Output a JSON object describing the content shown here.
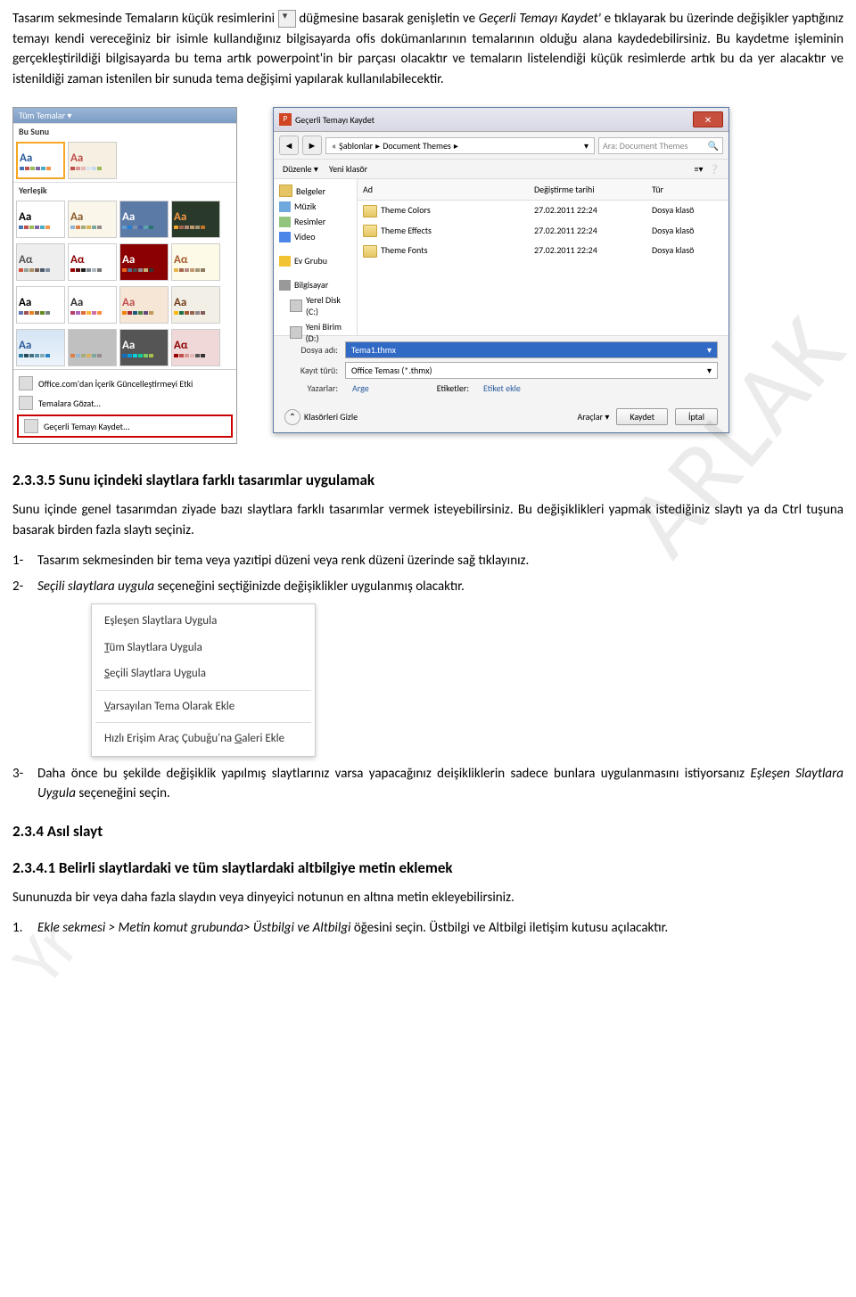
{
  "para1_a": "Tasarım sekmesinde  Temaların küçük resimlerini",
  "para1_b": "düğmesine basarak genişletin ve ",
  "para1_c": "Geçerli Temayı Kaydet'",
  "para1_d": " e tıklayarak bu üzerinde değişikler yaptığınız temayı kendi vereceğiniz bir isimle kullandığınız bilgisayarda ofis dokümanlarının temalarının olduğu alana kaydedebilirsiniz. Bu kaydetme işleminin gerçekleştirildiği bilgisayarda bu tema artık powerpoint'in bir parçası olacaktır ve temaların listelendiği küçük resimlerde artık bu da yer alacaktır ve istenildiği zaman istenilen bir sunuda tema değişimi yapılarak kullanılabilecektir.",
  "watermark1": "ARLAK",
  "watermark2": "Yr",
  "gallery": {
    "header": "Tüm Temalar ▾",
    "section1": "Bu Sunu",
    "section2": "Yerleşik",
    "footer_office": "Office.com'dan İçerik Güncelleştirmeyi Etki",
    "footer_browse": "Temalara Gözat...",
    "footer_save": "Geçerli Temayı Kaydet..."
  },
  "dialog": {
    "title": "Geçerli Temayı Kaydet",
    "crumb1": "Şablonlar",
    "crumb2": "Document Themes",
    "search_ph": "Ara: Document Themes",
    "tb_org": "Düzenle ▾",
    "tb_new": "Yeni klasör",
    "side": {
      "belgeler": "Belgeler",
      "muzik": "Müzik",
      "resimler": "Resimler",
      "video": "Video",
      "evgrubu": "Ev Grubu",
      "bilgisayar": "Bilgisayar",
      "disk_c": "Yerel Disk (C:)",
      "disk_d": "Yeni Birim (D:)"
    },
    "cols": {
      "name": "Ad",
      "date": "Değiştirme tarihi",
      "type": "Tür"
    },
    "rows": [
      {
        "name": "Theme Colors",
        "date": "27.02.2011 22:24",
        "type": "Dosya klasö"
      },
      {
        "name": "Theme Effects",
        "date": "27.02.2011 22:24",
        "type": "Dosya klasö"
      },
      {
        "name": "Theme Fonts",
        "date": "27.02.2011 22:24",
        "type": "Dosya klasö"
      }
    ],
    "file_label": "Dosya adı:",
    "file_value": "Tema1.thmx",
    "type_label": "Kayıt türü:",
    "type_value": "Office Teması (*.thmx)",
    "authors_label": "Yazarlar:",
    "authors_value": "Arge",
    "tags_label": "Etiketler:",
    "tags_value": "Etiket ekle",
    "hide": "Klasörleri Gizle",
    "tools": "Araçlar ▾",
    "save": "Kaydet",
    "cancel": "İptal"
  },
  "h_2335": "2.3.3.5 Sunu içindeki slaytlara farklı tasarımlar uygulamak",
  "para2": "Sunu içinde genel tasarımdan ziyade bazı slaytlara farklı tasarımlar vermek isteyebilirsiniz. Bu değişiklikleri yapmak istediğiniz slaytı ya da Ctrl tuşuna basarak birden fazla slaytı seçiniz.",
  "step1": "Tasarım sekmesinden bir tema veya yazıtipi  düzeni veya renk düzeni üzerinde sağ tıklayınız.",
  "step2_a": "Seçili slaytlara uygula",
  "step2_b": " seçeneğini seçtiğinizde değişiklikler uygulanmış olacaktır.",
  "ctx": {
    "i1": "Eşleşen Slaytlara Uygula",
    "i2_a": "T",
    "i2_b": "üm Slaytlara Uygula",
    "i3_a": "S",
    "i3_b": "eçili Slaytlara Uygula",
    "i4_a": "V",
    "i4_b": "arsayılan Tema Olarak Ekle",
    "i5_a": "Hızlı Erişim Araç Çubuğu'na ",
    "i5_b": "G",
    "i5_c": "aleri Ekle"
  },
  "step3_a": "Daha önce bu şekilde değişiklik yapılmış slaytlarınız varsa yapacağınız deişikliklerin sadece bunlara uygulanmasını istiyorsanız ",
  "step3_b": "Eşleşen Slaytlara Uygula",
  "step3_c": " seçeneğini seçin.",
  "h_234": "2.3.4 Asıl slayt",
  "h_2341": "2.3.4.1 Belirli slaytlardaki ve tüm slaytlardaki altbilgiye metin eklemek",
  "para3": "Sununuzda bir veya daha fazla slaydın veya dinyeyici notunun en altına metin ekleyebilirsiniz.",
  "step_ekle_a": "Ekle sekmesi > Metin komut grubunda> Üstbilgi ve Altbilgi",
  "step_ekle_b": " öğesini seçin. Üstbilgi ve Altbilgi iletişim kutusu açılacaktır."
}
